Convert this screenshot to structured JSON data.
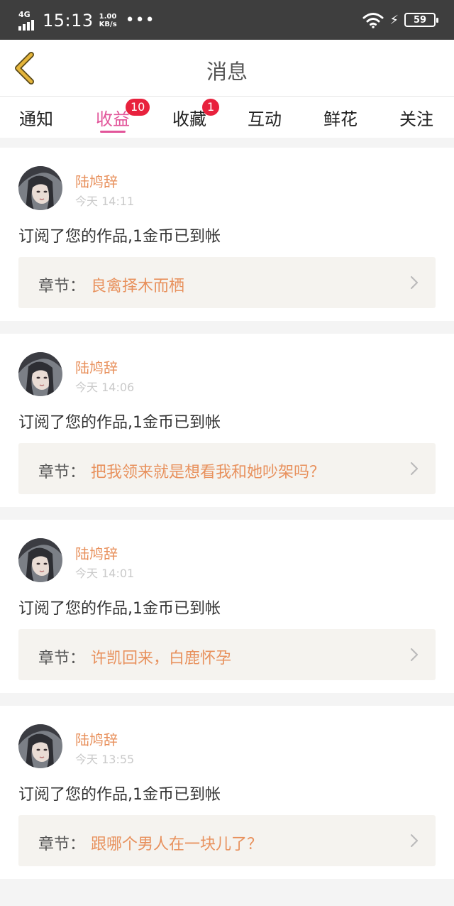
{
  "status_bar": {
    "network": "4G",
    "time": "15:13",
    "speed_value": "1.00",
    "speed_unit": "KB/s",
    "more": "•••",
    "battery": "59"
  },
  "header": {
    "title": "消息"
  },
  "tabs": [
    {
      "label": "通知"
    },
    {
      "label": "收益",
      "badge": "10",
      "active": true
    },
    {
      "label": "收藏",
      "badge": "1"
    },
    {
      "label": "互动"
    },
    {
      "label": "鲜花"
    },
    {
      "label": "关注"
    }
  ],
  "messages": [
    {
      "user": "陆鸠辞",
      "time": "今天 14:11",
      "text": "订阅了您的作品,1金币已到帐",
      "chapter_label": "章节：",
      "chapter_title": "良禽择木而栖"
    },
    {
      "user": "陆鸠辞",
      "time": "今天 14:06",
      "text": "订阅了您的作品,1金币已到帐",
      "chapter_label": "章节：",
      "chapter_title": "把我领来就是想看我和她吵架吗？"
    },
    {
      "user": "陆鸠辞",
      "time": "今天 14:01",
      "text": "订阅了您的作品,1金币已到帐",
      "chapter_label": "章节：",
      "chapter_title": "许凯回来，白鹿怀孕"
    },
    {
      "user": "陆鸠辞",
      "time": "今天 13:55",
      "text": "订阅了您的作品,1金币已到帐",
      "chapter_label": "章节：",
      "chapter_title": "跟哪个男人在一块儿了？"
    }
  ],
  "colors": {
    "accent_pink": "#e2559a",
    "username_orange": "#e8915d",
    "badge_red": "#e8213d",
    "back_arrow": "#e5b53a"
  }
}
